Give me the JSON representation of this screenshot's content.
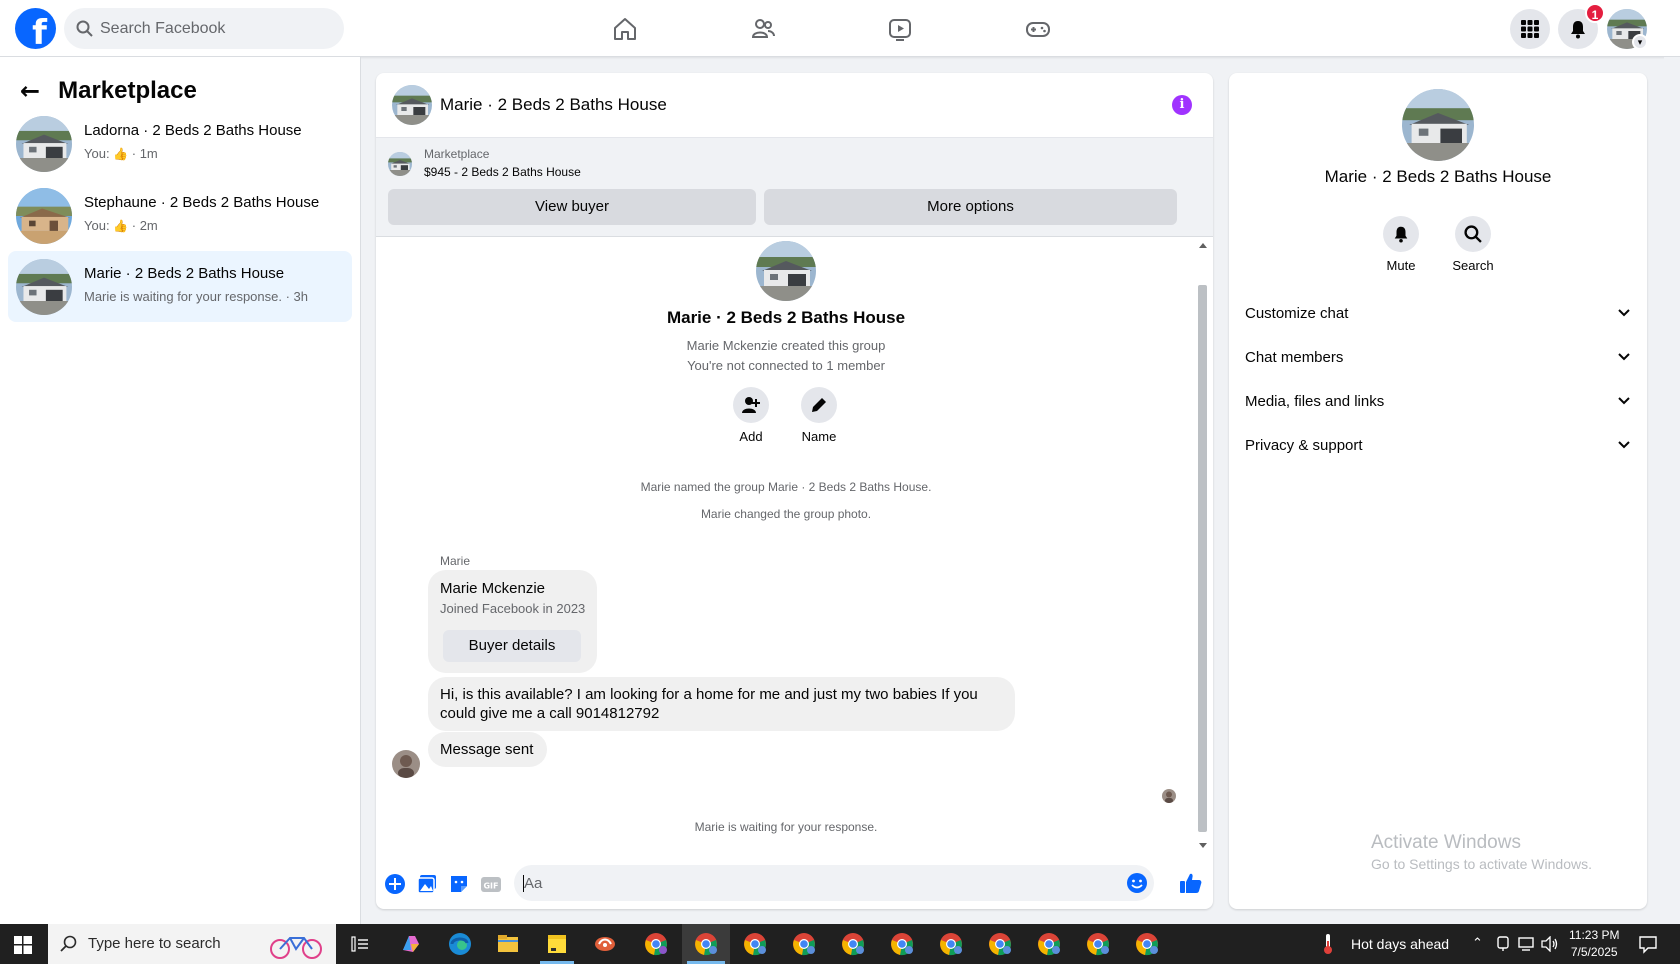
{
  "topnav": {
    "search_placeholder": "Search Facebook",
    "notification_count": "1"
  },
  "left": {
    "title": "Marketplace",
    "conversations": [
      {
        "title": "Ladorna · 2 Beds 2 Baths House",
        "prefix": "You:",
        "time": "· 1m"
      },
      {
        "title": "Stephaune · 2 Beds 2 Baths House",
        "prefix": "You:",
        "time": "· 2m"
      },
      {
        "title": "Marie · 2 Beds 2 Baths House",
        "preview": "Marie is waiting for your response. · 3h"
      }
    ]
  },
  "chat": {
    "title": "Marie · 2 Beds 2 Baths House",
    "marketplace_label": "Marketplace",
    "listing": "$945 - 2 Beds 2 Baths House",
    "view_buyer": "View buyer",
    "more_options": "More options",
    "group_name": "Marie · 2 Beds 2 Baths House",
    "created": "Marie Mckenzie created this group",
    "not_connected": "You're not connected to 1 member",
    "add_label": "Add",
    "name_label": "Name",
    "sys1": "Marie named the group Marie · 2 Beds 2 Baths House.",
    "sys2": "Marie changed the group photo.",
    "sender": "Marie",
    "card_name": "Marie Mckenzie",
    "card_joined": "Joined Facebook in 2023",
    "buyer_details": "Buyer details",
    "message1": "Hi, is this available? I am looking for a home for me and just my two babies If you could give me a call 9014812792",
    "message2": "Message sent",
    "waiting": "Marie is waiting for your response.",
    "composer_placeholder": "Aa"
  },
  "right": {
    "title": "Marie · 2 Beds 2 Baths House",
    "mute": "Mute",
    "search": "Search",
    "sections": [
      "Customize chat",
      "Chat members",
      "Media, files and links",
      "Privacy & support"
    ],
    "activate_title": "Activate Windows",
    "activate_sub": "Go to Settings to activate Windows."
  },
  "taskbar": {
    "search_text": "Type here to search",
    "weather": "Hot days ahead",
    "time": "11:23 PM",
    "date": "7/5/2025"
  },
  "colors": {
    "brand": "#0866ff",
    "active_row": "#ebf5ff",
    "info": "#a033ff",
    "badge": "#e41e3f"
  }
}
